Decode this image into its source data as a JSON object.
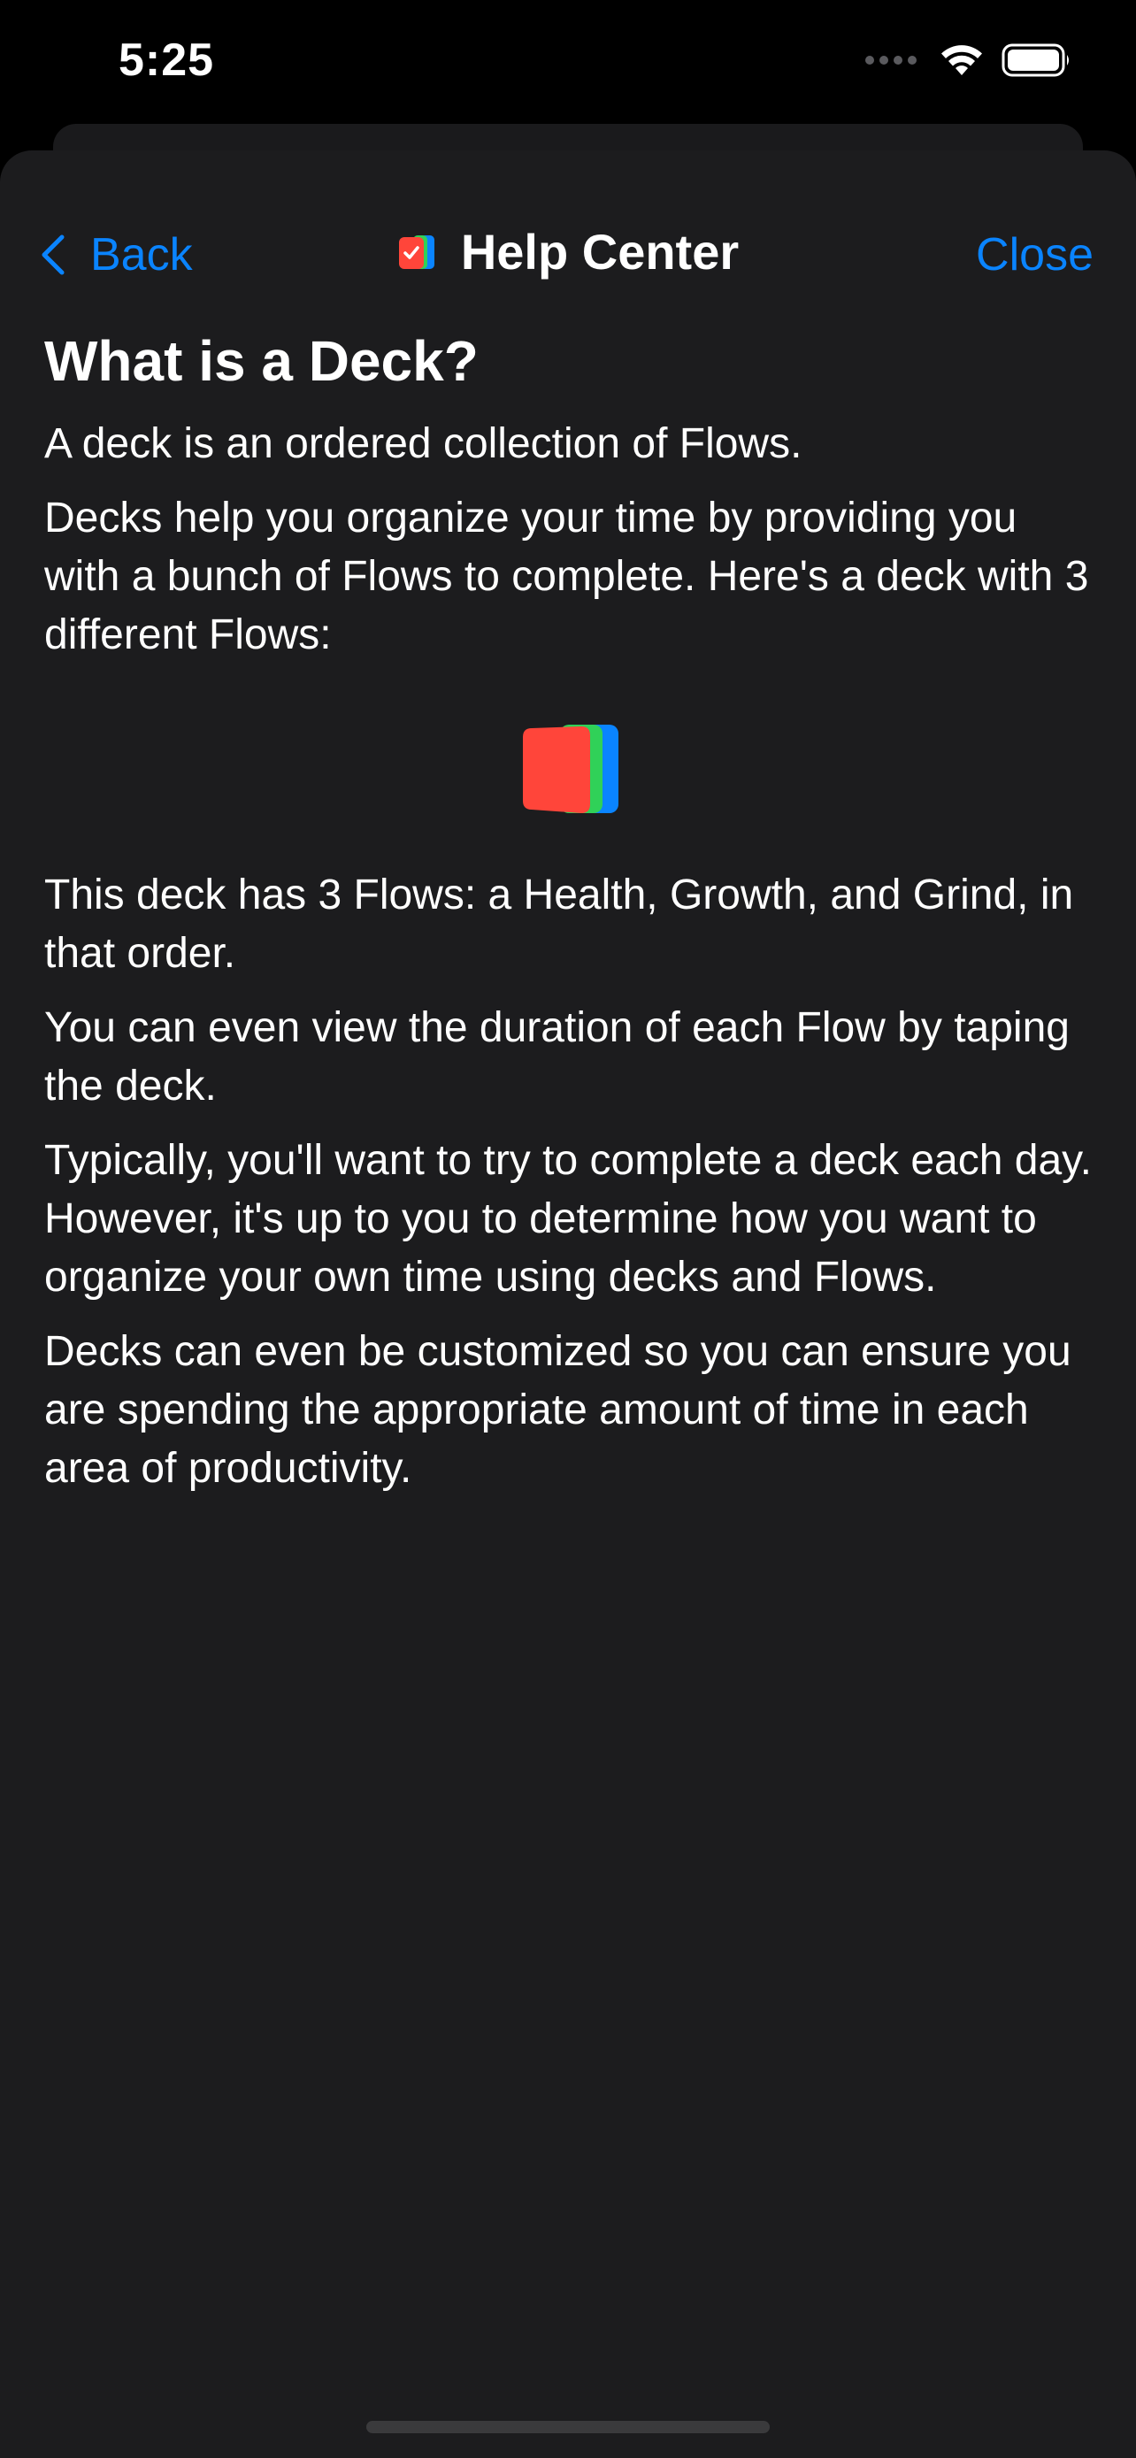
{
  "status_bar": {
    "time": "5:25",
    "icons": [
      "cellular-signal-icon",
      "wifi-icon",
      "battery-icon"
    ]
  },
  "nav": {
    "back_label": "Back",
    "title": "Help Center",
    "close_label": "Close",
    "app_icon": "deck-app-icon"
  },
  "article": {
    "heading": "What is a Deck?",
    "paragraphs": [
      "A deck is an ordered collection of Flows.",
      "Decks help you organize your time by providing you with a bunch of Flows to complete. Here's a deck with 3 different Flows:",
      "This deck has 3 Flows: a Health, Growth, and Grind, in that order.",
      "You can even view the duration of each Flow by taping the deck.",
      "Typically, you'll want to try to complete a deck each day. However, it's up to you to determine how you want to organize your own time using decks and Flows.",
      "Decks can even be customized so you can ensure you are spending the appropriate amount of time in each area of productivity."
    ],
    "deck_colors": {
      "health": "#ff453a",
      "growth": "#30d158",
      "grind": "#0a84ff"
    }
  },
  "colors": {
    "accent": "#0a84ff",
    "sheet_background": "#1c1c1e",
    "text": "#ffffff"
  }
}
